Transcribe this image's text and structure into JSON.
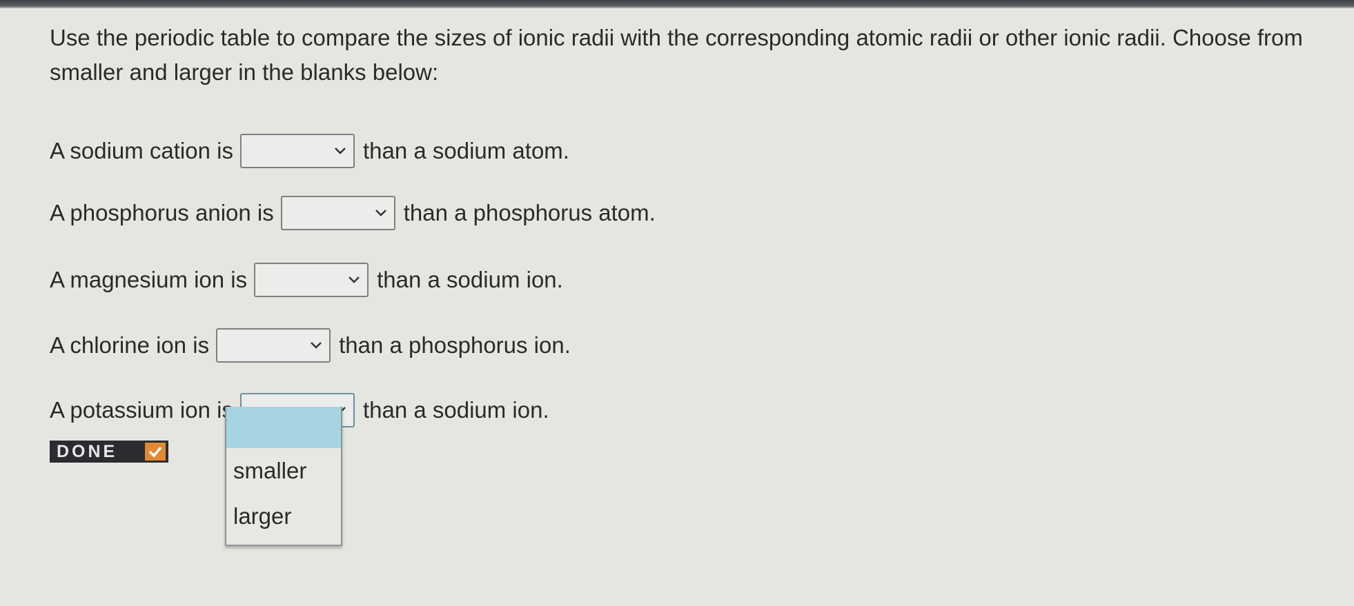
{
  "instructions": "Use the periodic table to compare the sizes of ionic radii with the corresponding atomic radii or other ionic radii. Choose from smaller and larger in the blanks below:",
  "questions": [
    {
      "before": "A sodium cation is",
      "after": "than a sodium atom.",
      "value": ""
    },
    {
      "before": "A phosphorus anion is",
      "after": "than a phosphorus atom.",
      "value": ""
    },
    {
      "before": "A magnesium ion is",
      "after": "than a sodium ion.",
      "value": ""
    },
    {
      "before": "A chlorine ion is",
      "after": "than a phosphorus ion.",
      "value": ""
    },
    {
      "before": "A potassium ion is",
      "after": "than a sodium ion.",
      "value": ""
    }
  ],
  "done_button": {
    "label": "DONE",
    "icon": "checkmark-icon"
  },
  "dropdown": {
    "options": [
      "smaller",
      "larger"
    ],
    "highlighted_option": ""
  },
  "colors": {
    "background": "#e6e6e1",
    "highlight": "#a7d4e1",
    "done_bg": "#2a2c2f",
    "done_check": "#e28a32"
  }
}
